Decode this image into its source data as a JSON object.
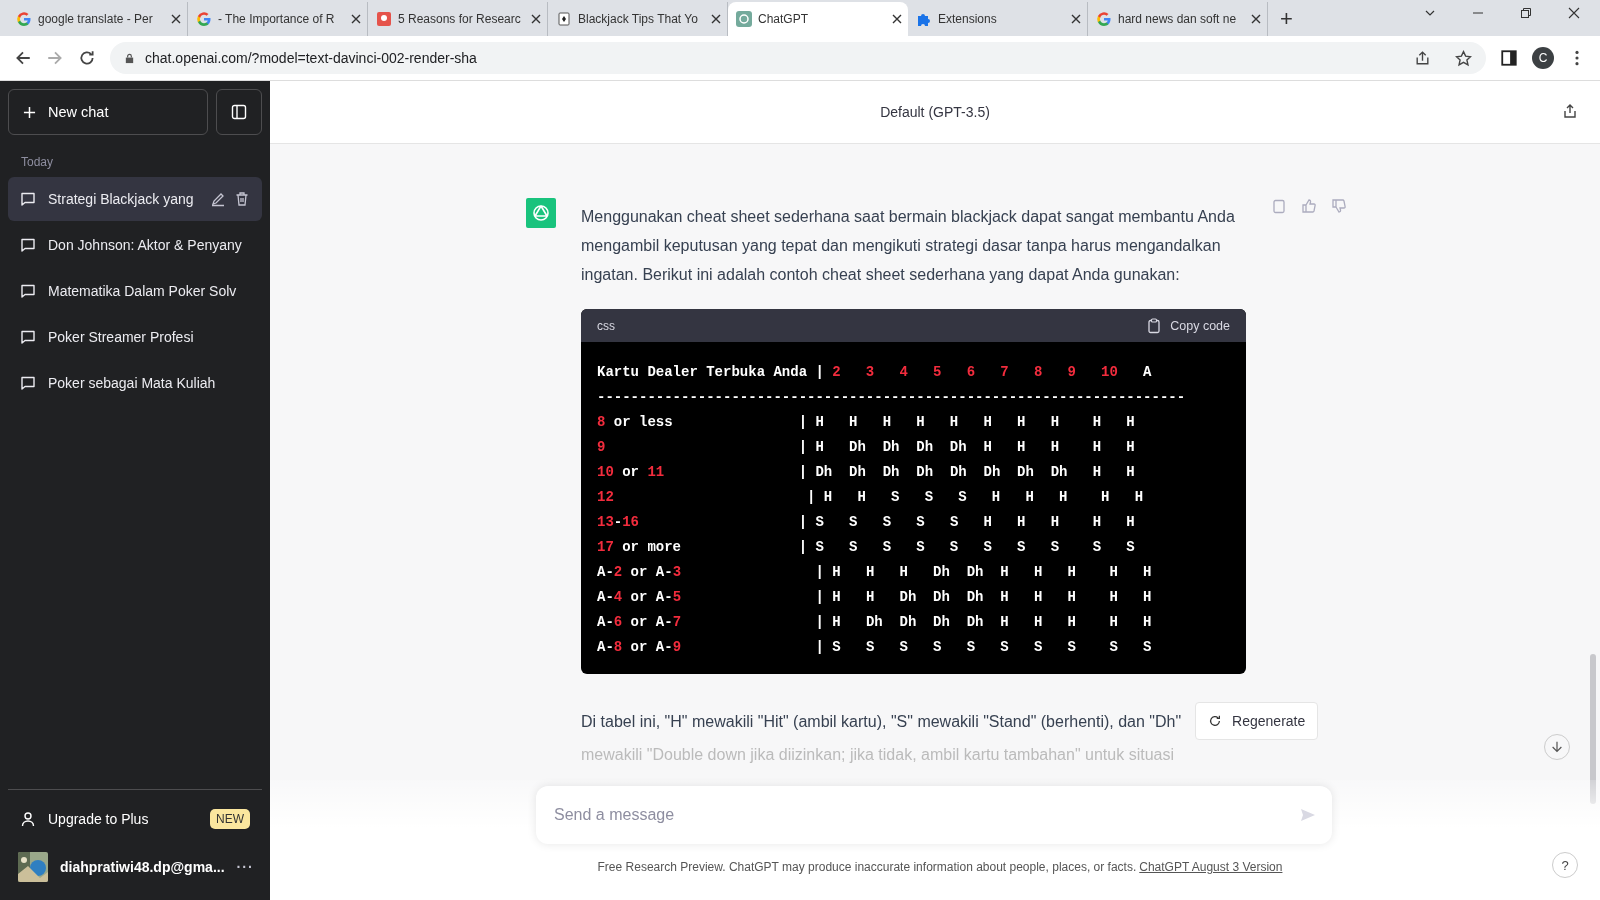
{
  "browser": {
    "tabs": [
      {
        "title": "google translate - Per",
        "kind": "google",
        "selected": false
      },
      {
        "title": "- The Importance of R",
        "kind": "google",
        "selected": false
      },
      {
        "title": "5 Reasons for Researc",
        "kind": "red",
        "selected": false
      },
      {
        "title": "Blackjack Tips That Yo",
        "kind": "card",
        "selected": false
      },
      {
        "title": "ChatGPT",
        "kind": "chatgpt",
        "selected": true
      },
      {
        "title": "Extensions",
        "kind": "puzzle",
        "selected": false
      },
      {
        "title": "hard news dan soft ne",
        "kind": "google",
        "selected": false
      }
    ],
    "new_tab": "+",
    "url": "chat.openai.com/?model=text-davinci-002-render-sha",
    "profile": "C"
  },
  "sidebar": {
    "new_chat": "New chat",
    "section": "Today",
    "chats": [
      {
        "title": "Strategi Blackjack yang",
        "selected": true
      },
      {
        "title": "Don Johnson: Aktor & Penyany",
        "selected": false
      },
      {
        "title": "Matematika Dalam Poker Solv",
        "selected": false
      },
      {
        "title": "Poker Streamer Profesi",
        "selected": false
      },
      {
        "title": "Poker sebagai Mata Kuliah",
        "selected": false
      }
    ],
    "upgrade": "Upgrade to Plus",
    "upgrade_badge": "NEW",
    "user": "diahpratiwi48.dp@gma...",
    "user_menu": "···"
  },
  "header": {
    "model": "Default (GPT-3.5)"
  },
  "message": {
    "intro": "Menggunakan cheat sheet sederhana saat bermain blackjack dapat sangat membantu Anda mengambil keputusan yang tepat dan mengikuti strategi dasar tanpa harus mengandalkan ingatan. Berikut ini adalah contoh cheat sheet sederhana yang dapat Anda gunakan:",
    "code": {
      "language": "css",
      "copy": "Copy code",
      "lines": [
        "Kartu Dealer Terbuka Anda | *2   3   4   5   6   7   8   9   10*   A",
        "----------------------------------------------------------------------",
        "*8* or less               | H   H   H   H   H   H   H   H    H   H",
        "*9*                       | H   Dh  Dh  Dh  Dh  H   H   H    H   H",
        "*10* or *11*                | Dh  Dh  Dh  Dh  Dh  Dh  Dh  Dh   H   H",
        "*12*                       | H   H   S   S   S   H   H   H    H   H",
        "*13*-*16*                   | S   S   S   S   S   H   H   H    H   H",
        "*17* or more              | S   S   S   S   S   S   S   S    S   S",
        "A-*2* or A-*3*                | H   H   H   Dh  Dh  H   H   H    H   H",
        "A-*4* or A-*5*                | H   H   Dh  Dh  Dh  H   H   H    H   H",
        "A-*6* or A-*7*                | H   Dh  Dh  Dh  Dh  H   H   H    H   H",
        "A-*8* or A-*9*                | S   S   S   S   S   S   S   S    S   S"
      ]
    },
    "outro": "Di tabel ini, \"H\" mewakili \"Hit\" (ambil kartu), \"S\" mewakili \"Stand\" (berhenti), dan \"Dh\"",
    "outro_faded": "mewakili \"Double down jika diizinkan; jika tidak, ambil kartu tambahan\" untuk situasi"
  },
  "regenerate": "Regenerate",
  "composer": {
    "placeholder": "Send a message"
  },
  "footer": {
    "text": "Free Research Preview. ChatGPT may produce inaccurate information about people, places, or facts.",
    "link": "ChatGPT August 3 Version"
  },
  "help": "?"
}
